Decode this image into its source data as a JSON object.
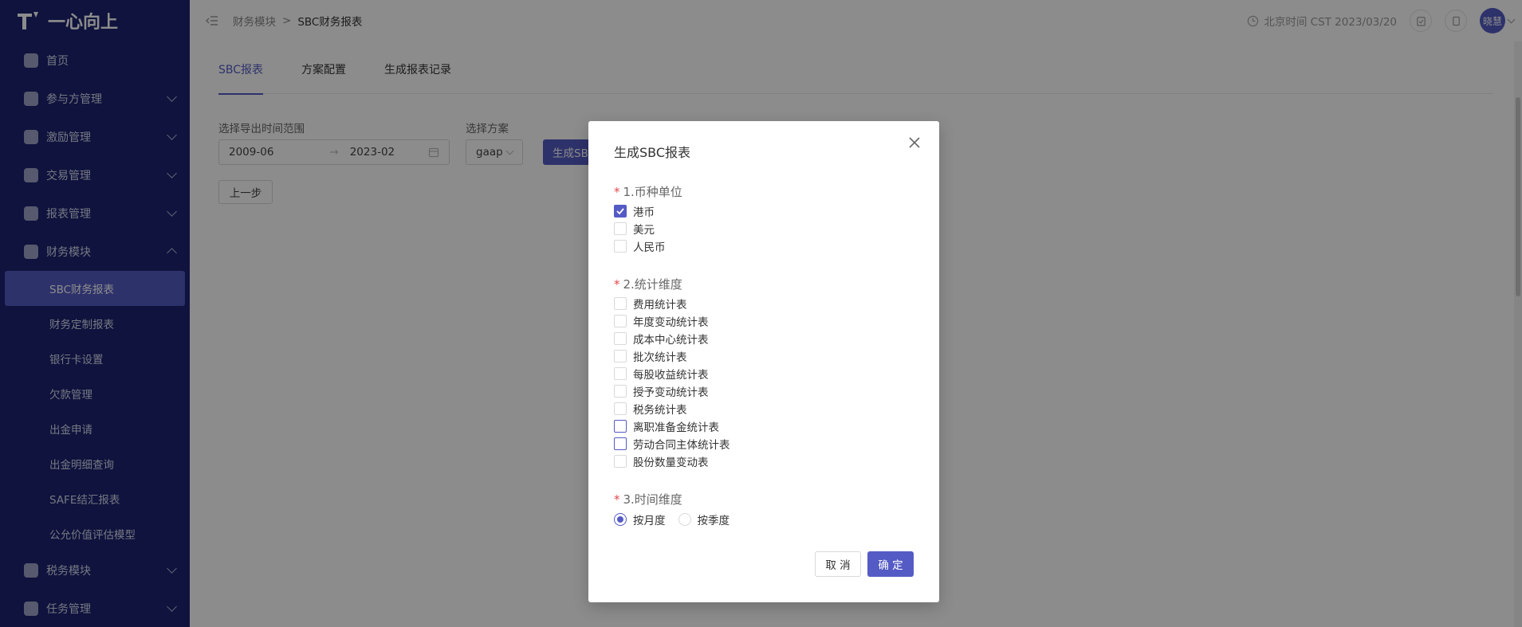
{
  "sidebar": {
    "logo_text": "一心向上",
    "items": [
      {
        "label": "首页",
        "has_children": false
      },
      {
        "label": "参与方管理",
        "has_children": true
      },
      {
        "label": "激励管理",
        "has_children": true
      },
      {
        "label": "交易管理",
        "has_children": true
      },
      {
        "label": "报表管理",
        "has_children": true
      },
      {
        "label": "财务模块",
        "has_children": true,
        "expanded": true,
        "children": [
          "SBC财务报表",
          "财务定制报表",
          "银行卡设置",
          "欠款管理",
          "出金申请",
          "出金明细查询",
          "SAFE结汇报表",
          "公允价值评估模型"
        ]
      },
      {
        "label": "税务模块",
        "has_children": true
      },
      {
        "label": "任务管理",
        "has_children": true
      }
    ]
  },
  "header": {
    "breadcrumb": [
      "财务模块",
      "SBC财务报表"
    ],
    "time_text": "北京时间 CST 2023/03/20",
    "avatar_text": "晓慧"
  },
  "main": {
    "tabs": [
      "SBC报表",
      "方案配置",
      "生成报表记录"
    ],
    "range_label": "选择导出时间范围",
    "range_start": "2009-06",
    "range_end": "2023-02",
    "plan_label": "选择方案",
    "plan_value": "gaap",
    "generate_label": "生成SBC",
    "prev_label": "上一步"
  },
  "modal": {
    "title": "生成SBC报表",
    "section1": {
      "title": "1.币种单位",
      "options": [
        {
          "label": "港币",
          "checked": true
        },
        {
          "label": "美元",
          "checked": false
        },
        {
          "label": "人民币",
          "checked": false
        }
      ]
    },
    "section2": {
      "title": "2.统计维度",
      "options": [
        {
          "label": "费用统计表",
          "checked": false
        },
        {
          "label": "年度变动统计表",
          "checked": false
        },
        {
          "label": "成本中心统计表",
          "checked": false
        },
        {
          "label": "批次统计表",
          "checked": false
        },
        {
          "label": "每股收益统计表",
          "checked": false
        },
        {
          "label": "授予变动统计表",
          "checked": false
        },
        {
          "label": "税务统计表",
          "checked": false
        },
        {
          "label": "离职准备金统计表",
          "checked": false
        },
        {
          "label": "劳动合同主体统计表",
          "checked": false
        },
        {
          "label": "股份数量变动表",
          "checked": false
        }
      ]
    },
    "section3": {
      "title": "3.时间维度",
      "options": [
        {
          "label": "按月度",
          "selected": true
        },
        {
          "label": "按季度",
          "selected": false
        }
      ]
    },
    "cancel_label": "取 消",
    "ok_label": "确 定"
  },
  "colors": {
    "accent": "#555bc4",
    "sidebar_bg": "#1d2470",
    "required": "#e5484d"
  }
}
